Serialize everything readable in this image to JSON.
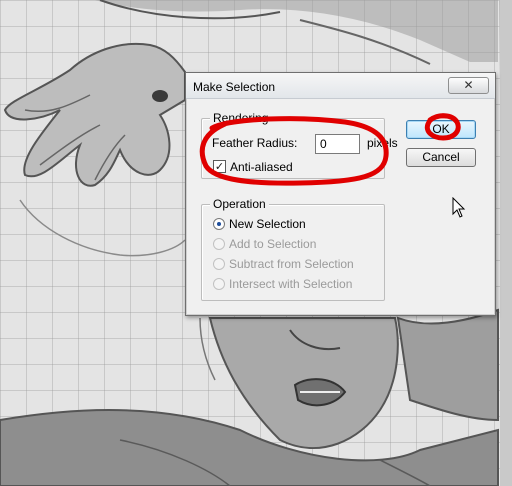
{
  "dialog": {
    "title": "Make Selection",
    "close_glyph": "✕",
    "rendering": {
      "legend": "Rendering",
      "feather_label": "Feather Radius:",
      "feather_value": "0",
      "feather_unit": "pixels",
      "antialiased_label": "Anti-aliased",
      "antialiased_checked": true
    },
    "operation": {
      "legend": "Operation",
      "options": [
        {
          "label": "New Selection",
          "selected": true,
          "enabled": true
        },
        {
          "label": "Add to Selection",
          "selected": false,
          "enabled": false
        },
        {
          "label": "Subtract from Selection",
          "selected": false,
          "enabled": false
        },
        {
          "label": "Intersect with Selection",
          "selected": false,
          "enabled": false
        }
      ]
    },
    "ok_label": "OK",
    "cancel_label": "Cancel"
  },
  "icons": {
    "close": "close-icon",
    "check": "checkmark-icon",
    "cursor": "mouse-pointer-icon"
  },
  "colors": {
    "annotation": "#e00000",
    "ok_border": "#3c7fb1",
    "radio_dot": "#1f4e9c"
  }
}
